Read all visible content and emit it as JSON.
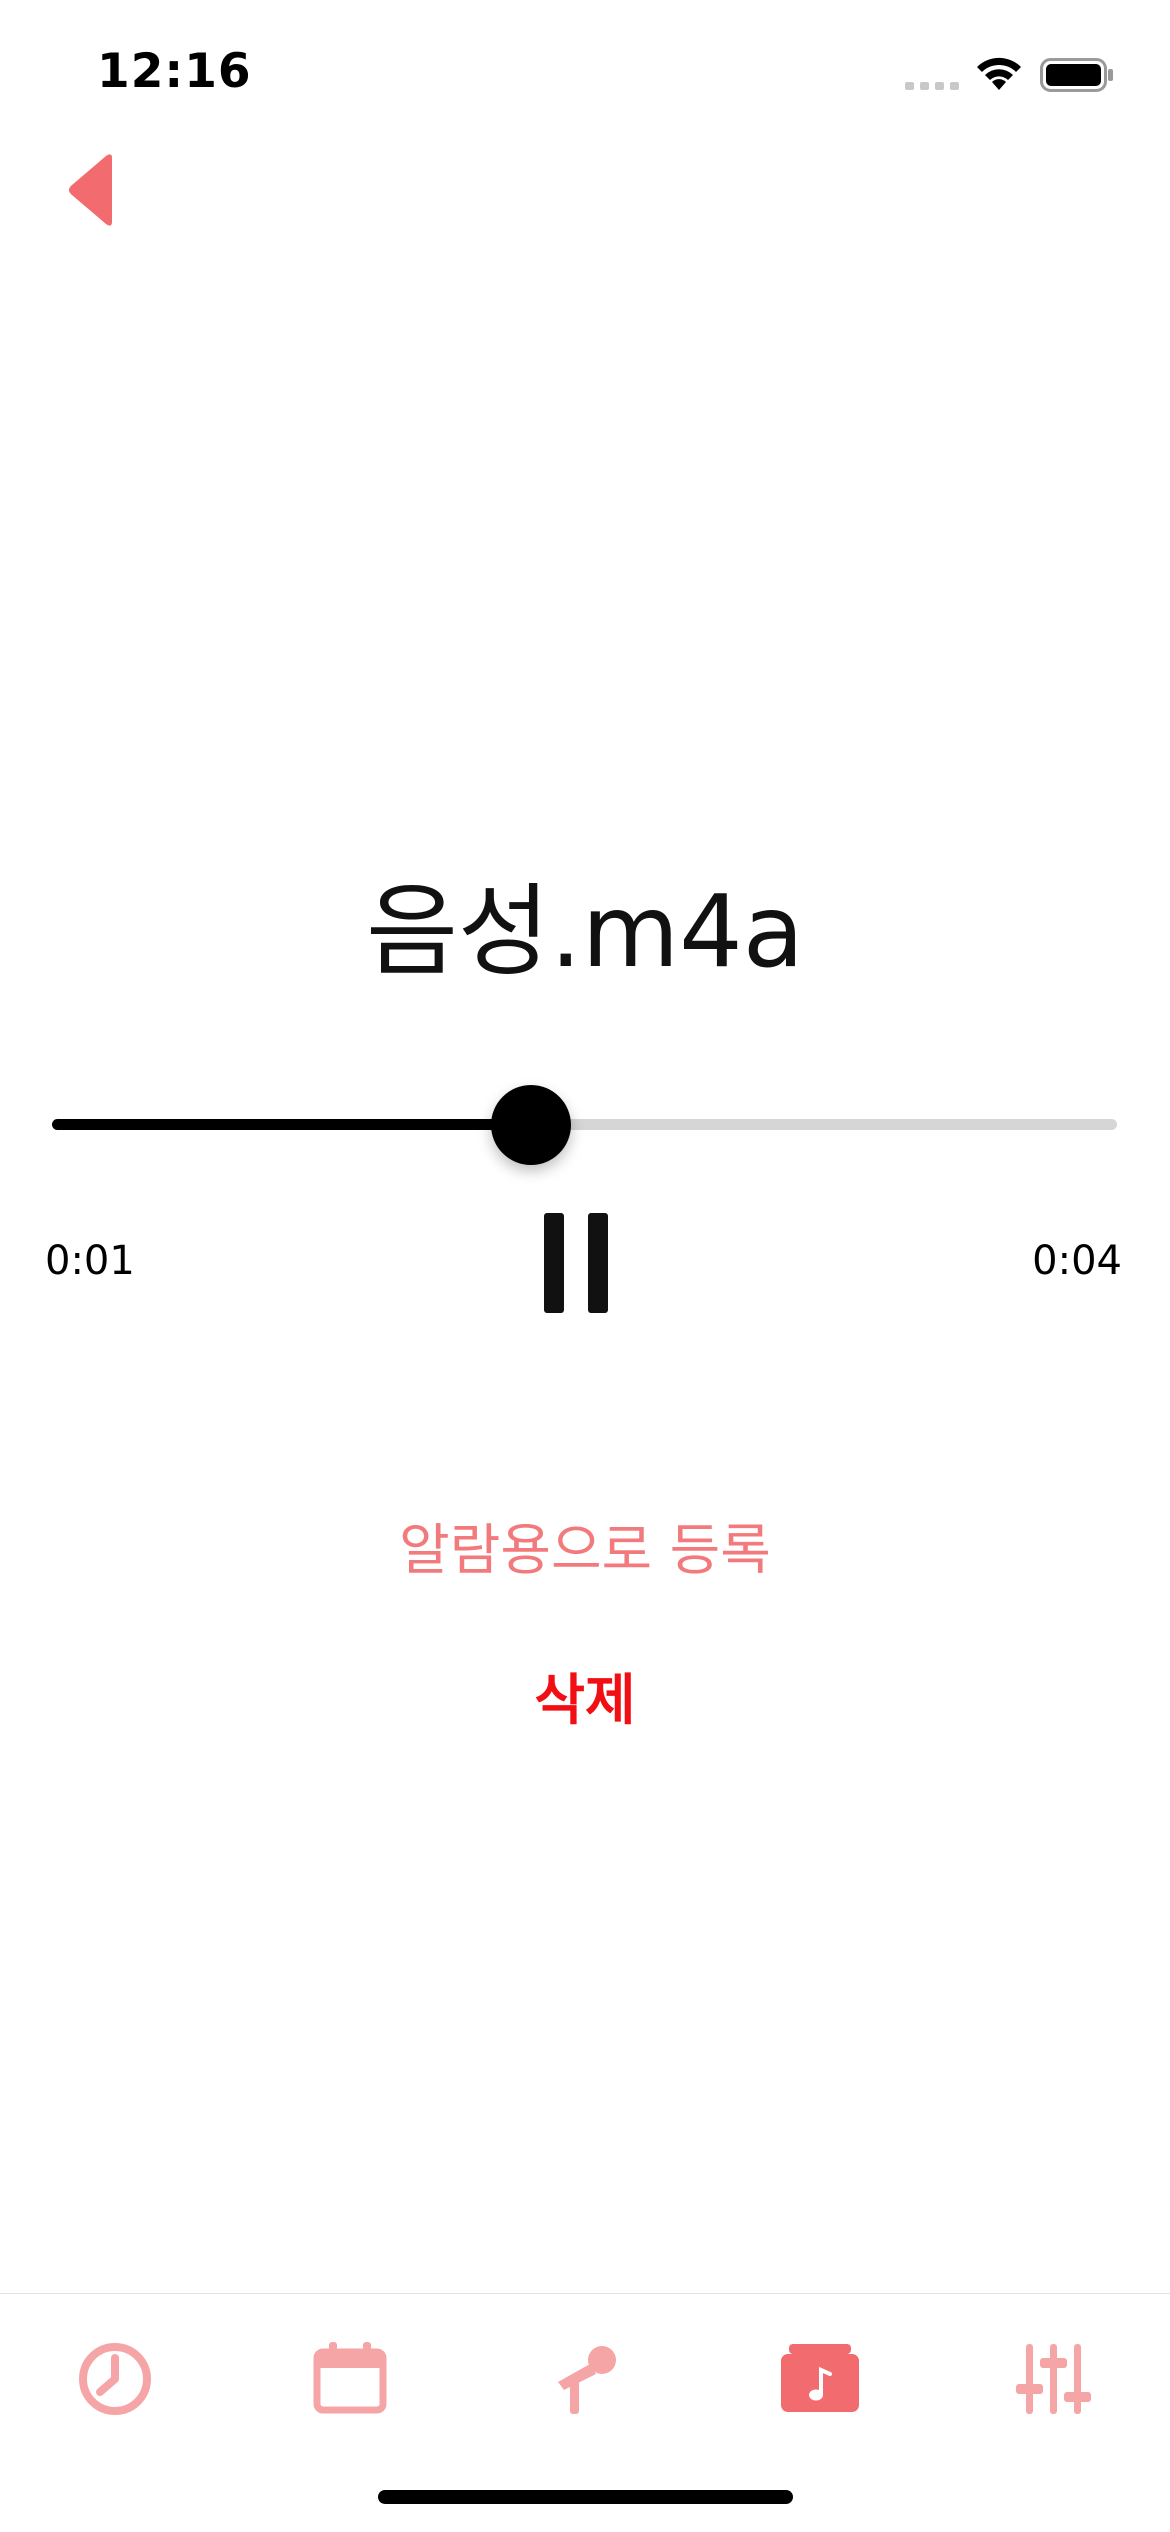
{
  "status_bar": {
    "time": "12:16"
  },
  "player": {
    "title": "음성.m4a",
    "elapsed": "0:01",
    "total": "0:04",
    "progress": 0.45
  },
  "actions": {
    "register_alarm": "알람용으로 등록",
    "delete": "삭제"
  },
  "tabs": [
    {
      "icon": "clock-icon",
      "selected": false
    },
    {
      "icon": "calendar-icon",
      "selected": false
    },
    {
      "icon": "microphone-icon",
      "selected": false
    },
    {
      "icon": "music-folder-icon",
      "selected": true
    },
    {
      "icon": "sliders-icon",
      "selected": false
    }
  ],
  "colors": {
    "accent": "#f26b6e",
    "accent_light": "#f6a5a7",
    "delete_red": "#f20f14"
  }
}
